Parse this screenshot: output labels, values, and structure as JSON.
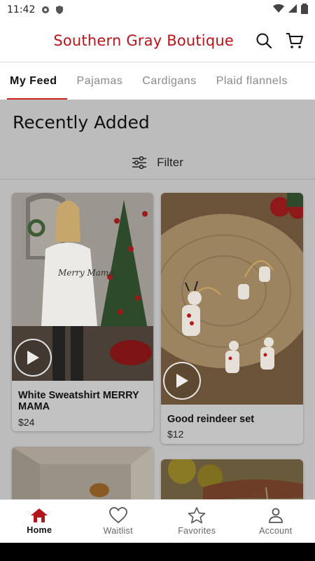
{
  "status_bar": {
    "time": "11:42"
  },
  "header": {
    "brand": "Southern Gray Boutique"
  },
  "tabs": [
    {
      "label": "My Feed"
    },
    {
      "label": "Pajamas"
    },
    {
      "label": "Cardigans"
    },
    {
      "label": "Plaid flannels"
    }
  ],
  "feed": {
    "title": "Recently Added",
    "filter_label": "Filter",
    "products": [
      {
        "title": "White Sweatshirt MERRY MAMA",
        "price": "$24"
      },
      {
        "title": "Good reindeer set",
        "price": "$12"
      }
    ],
    "sweatshirt_print": "Merry Mama"
  },
  "bottom_nav": [
    {
      "label": "Home",
      "icon": "home-icon"
    },
    {
      "label": "Waitlist",
      "icon": "heart-icon"
    },
    {
      "label": "Favorites",
      "icon": "star-icon"
    },
    {
      "label": "Account",
      "icon": "person-icon"
    }
  ],
  "colors": {
    "brand": "#b3151b",
    "tab_indicator": "#d21f1f",
    "home_active": "#b3151b"
  }
}
